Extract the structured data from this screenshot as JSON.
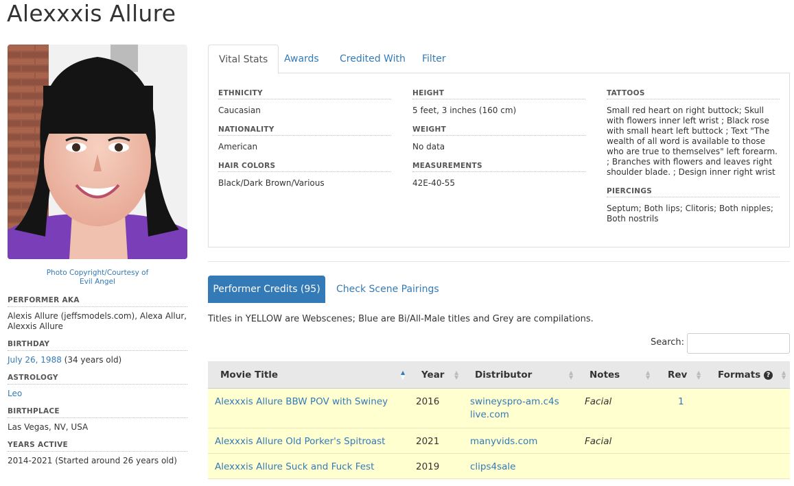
{
  "page": {
    "title": "Alexxxis Allure"
  },
  "photo": {
    "credit_line1": "Photo Copyright/Courtesy of",
    "credit_line2": "Evil Angel"
  },
  "bio": [
    {
      "label": "PERFORMER AKA",
      "value": "Alexis Allure (jeffsmodels.com), Alexa Allur, Alexxis Allure"
    },
    {
      "label": "BIRTHDAY",
      "value_link": "July 26, 1988",
      "value_rest": " (34 years old)"
    },
    {
      "label": "ASTROLOGY",
      "value_link": "Leo"
    },
    {
      "label": "BIRTHPLACE",
      "value": "Las Vegas, NV, USA"
    },
    {
      "label": "YEARS ACTIVE",
      "value": "2014-2021 (Started around 26 years old)"
    }
  ],
  "tabs": [
    "Vital Stats",
    "Awards",
    "Credited With",
    "Filter"
  ],
  "stats": {
    "ethnicity": {
      "label": "ETHNICITY",
      "value": "Caucasian"
    },
    "nationality": {
      "label": "NATIONALITY",
      "value": "American"
    },
    "hair": {
      "label": "HAIR COLORS",
      "value": "Black/Dark Brown/Various"
    },
    "height": {
      "label": "HEIGHT",
      "value": "5 feet, 3 inches (160 cm)"
    },
    "weight": {
      "label": "WEIGHT",
      "value": "No data"
    },
    "measurements": {
      "label": "MEASUREMENTS",
      "value": "42E-40-55"
    },
    "tattoos": {
      "label": "TATTOOS",
      "value": "Small red heart on right buttock; Skull with flowers inner left wrist ; Black rose with small heart left buttock ; Text \"The wealth of all word is available to those who are true to themselves\" left forearm. ; Branches with flowers and leaves right shoulder blade. ; Design inner right wrist"
    },
    "piercings": {
      "label": "PIERCINGS",
      "value": "Septum; Both lips; Clitoris; Both nipples; Both nostrils"
    }
  },
  "credits": {
    "button_label": "Performer Credits (95)",
    "pairings_label": "Check Scene Pairings",
    "legend": "Titles in YELLOW are Webscenes; Blue are Bi/All-Male titles and Grey are compilations.",
    "search_label": "Search:",
    "search_value": "",
    "columns": [
      "Movie Title",
      "Year",
      "Distributor",
      "Notes",
      "Rev",
      "Formats"
    ],
    "rows": [
      {
        "title": "Alexxxis Allure BBW POV with Swiney",
        "year": "2016",
        "distributor": "swineyspro-am.c4slive.com",
        "notes": "Facial",
        "rev": "1",
        "formats": ""
      },
      {
        "title": "Alexxxis Allure Old Porker's Spitroast",
        "year": "2021",
        "distributor": "manyvids.com",
        "notes": "Facial",
        "rev": "",
        "formats": ""
      },
      {
        "title": "Alexxxis Allure Suck and Fuck Fest",
        "year": "2019",
        "distributor": "clips4sale",
        "notes": "",
        "rev": "",
        "formats": ""
      }
    ]
  },
  "icons": {
    "help": "question-circle-icon",
    "sort": "sort-arrows-icon"
  },
  "colors": {
    "accent": "#337ab7",
    "webscene_row": "#ffffd0",
    "header_bg": "#e8e8e8"
  }
}
